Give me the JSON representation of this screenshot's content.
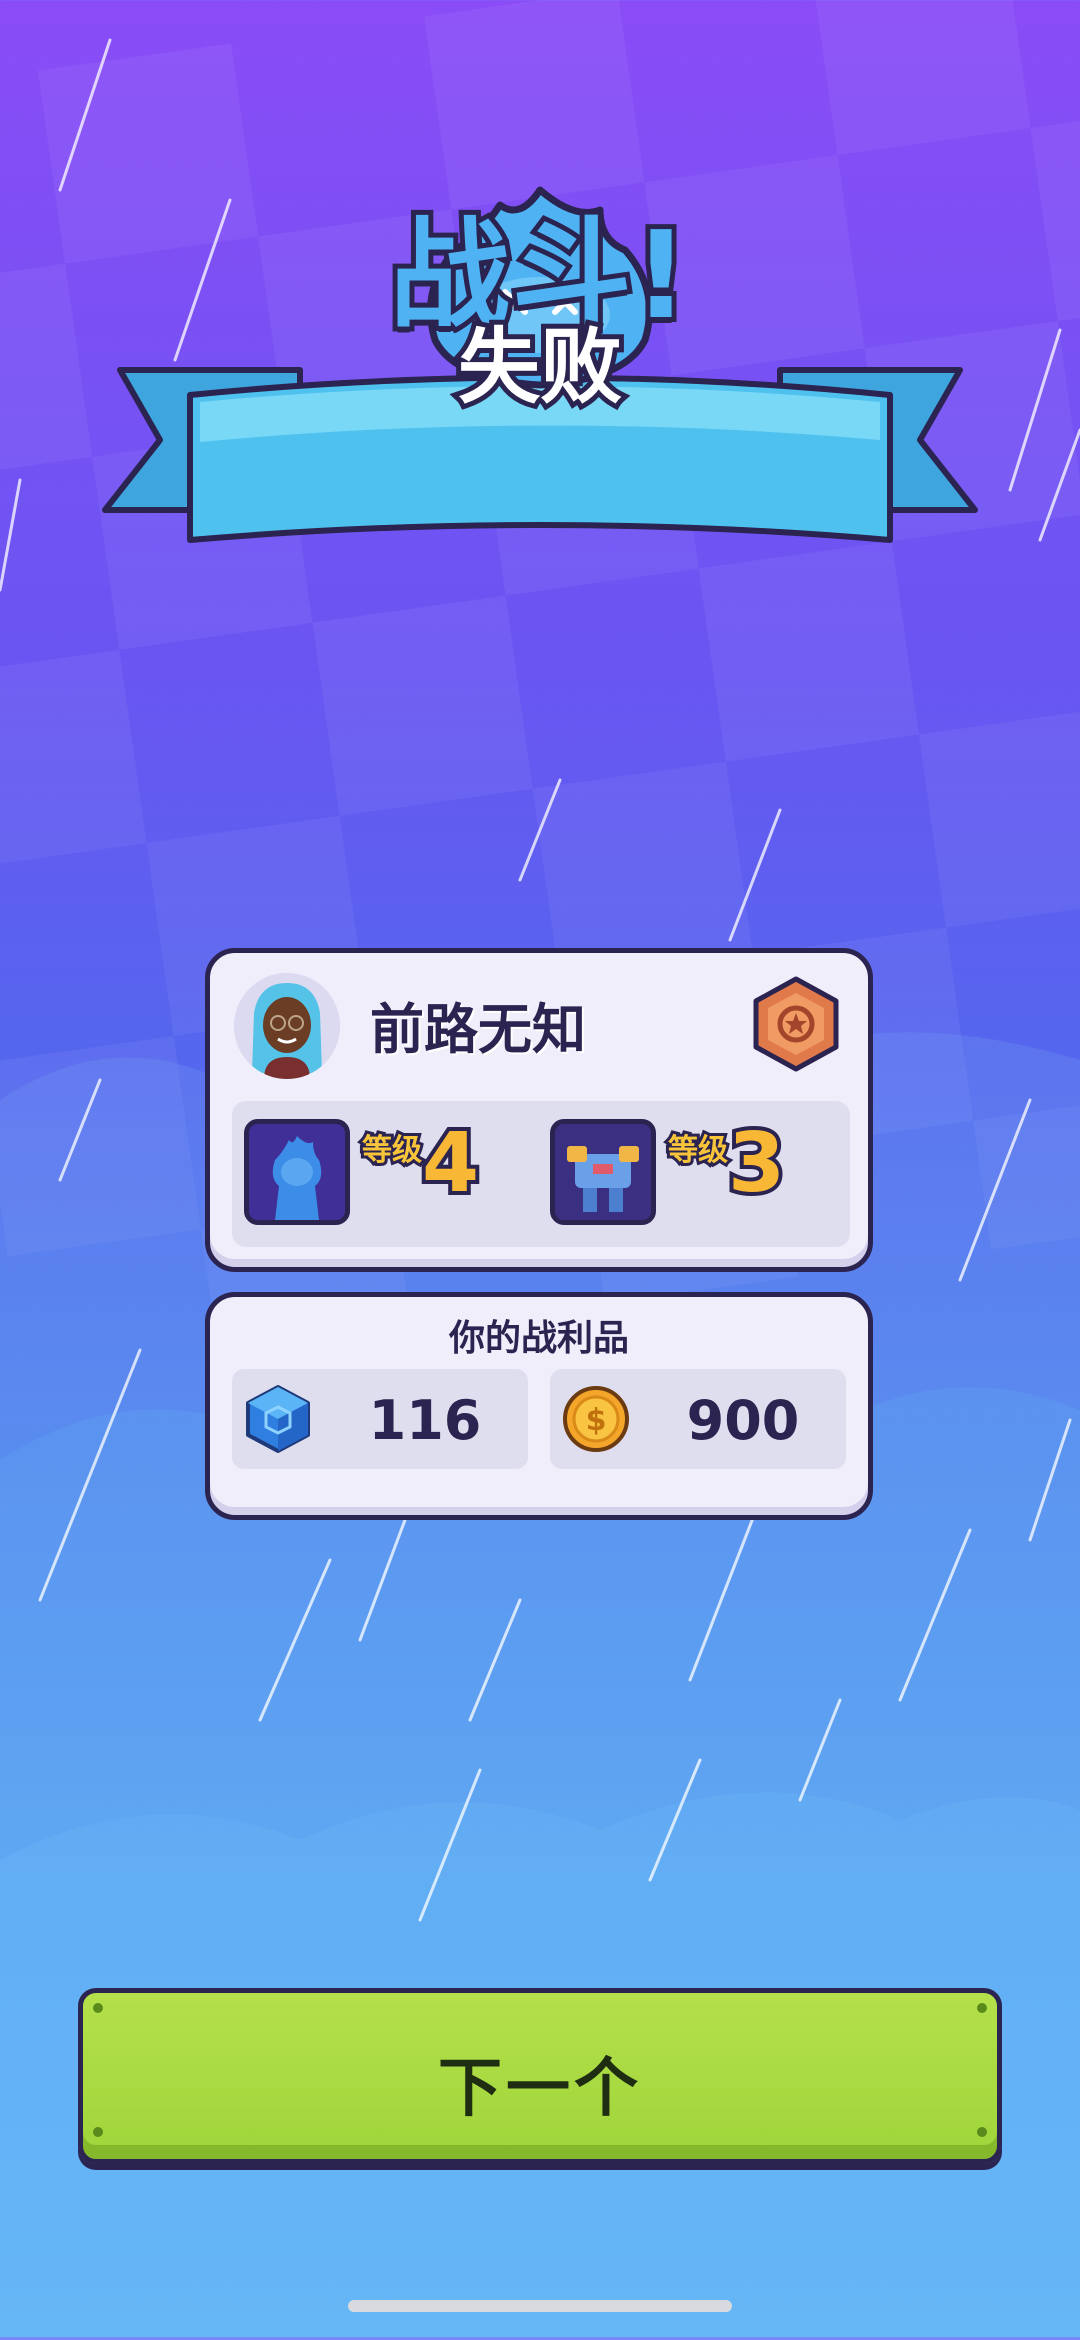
{
  "result": {
    "title": "战斗!",
    "subtitle": "失败"
  },
  "player": {
    "name": "前路无知",
    "units": [
      {
        "level_label": "等级",
        "level": "4",
        "icon": "blue-hero-icon"
      },
      {
        "level_label": "等级",
        "level": "3",
        "icon": "robot-hero-icon"
      }
    ]
  },
  "loot": {
    "title": "你的战利品",
    "items": [
      {
        "icon": "blue-gem-cube-icon",
        "value": "116"
      },
      {
        "icon": "gold-coin-icon",
        "value": "900"
      }
    ]
  },
  "actions": {
    "next_label": "下一个"
  },
  "colors": {
    "accent_outline": "#2b2350",
    "button_green": "#a6d83f",
    "ribbon_blue": "#4fc1ef",
    "level_gold": "#f8b835"
  }
}
